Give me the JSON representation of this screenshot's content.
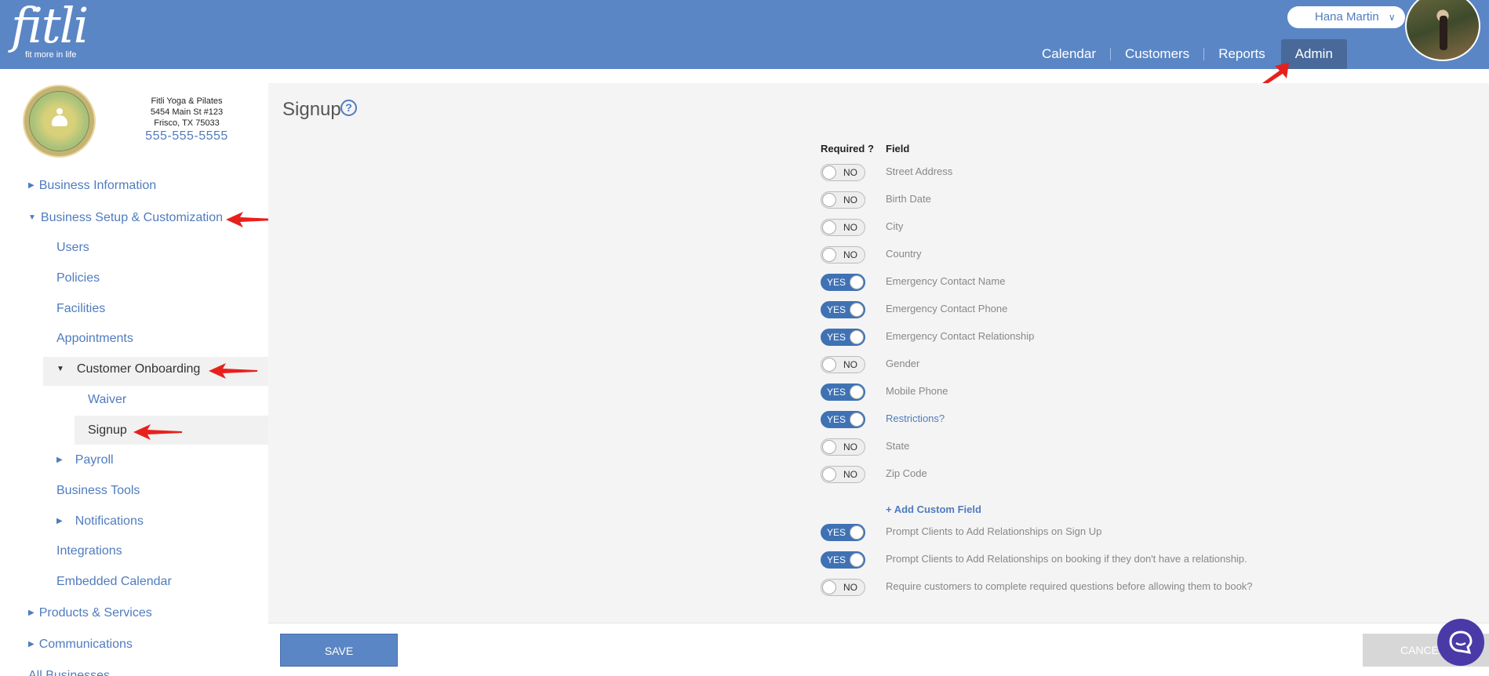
{
  "header": {
    "logo_text": "fitli",
    "logo_tagline": "fit more in life",
    "user_name": "Hana Martin",
    "nav": [
      {
        "label": "Calendar"
      },
      {
        "label": "Customers"
      },
      {
        "label": "Reports"
      },
      {
        "label": "Admin",
        "active": true
      }
    ]
  },
  "business": {
    "name": "Fitli Yoga & Pilates",
    "address1": "5454 Main St #123",
    "address2": "Frisco, TX 75033",
    "phone": "555-555-5555"
  },
  "sidebar": {
    "business_information": "Business Information",
    "business_setup": "Business Setup & Customization",
    "users": "Users",
    "policies": "Policies",
    "facilities": "Facilities",
    "appointments": "Appointments",
    "customer_onboarding": "Customer Onboarding",
    "waiver": "Waiver",
    "signup": "Signup",
    "payroll": "Payroll",
    "business_tools": "Business Tools",
    "notifications": "Notifications",
    "integrations": "Integrations",
    "embedded_calendar": "Embedded Calendar",
    "products_services": "Products & Services",
    "communications": "Communications",
    "all_businesses": "All Businesses"
  },
  "main": {
    "title": "Signup",
    "help_icon": "?",
    "col_required": "Required ?",
    "col_field": "Field",
    "fields": [
      {
        "label": "Street Address",
        "state": "NO"
      },
      {
        "label": "Birth Date",
        "state": "NO"
      },
      {
        "label": "City",
        "state": "NO"
      },
      {
        "label": "Country",
        "state": "NO"
      },
      {
        "label": "Emergency Contact Name",
        "state": "YES"
      },
      {
        "label": "Emergency Contact Phone",
        "state": "YES"
      },
      {
        "label": "Emergency Contact Relationship",
        "state": "YES"
      },
      {
        "label": "Gender",
        "state": "NO"
      },
      {
        "label": "Mobile Phone",
        "state": "YES"
      },
      {
        "label": "Restrictions?",
        "state": "YES"
      },
      {
        "label": "State",
        "state": "NO"
      },
      {
        "label": "Zip Code",
        "state": "NO"
      }
    ],
    "add_custom_field": "+ Add Custom Field",
    "options": [
      {
        "label": "Prompt Clients to Add Relationships on Sign Up",
        "state": "YES"
      },
      {
        "label": "Prompt Clients to Add Relationships on booking if they don't have a relationship.",
        "state": "YES"
      },
      {
        "label": "Require customers to complete required questions before allowing them to book?",
        "state": "NO"
      }
    ],
    "save_label": "SAVE",
    "cancel_label": "CANCEL"
  },
  "colors": {
    "header": "#5b86c5",
    "accent": "#4f7cbf",
    "toggle_on": "#3f72b4",
    "chat": "#4a3aa8"
  }
}
